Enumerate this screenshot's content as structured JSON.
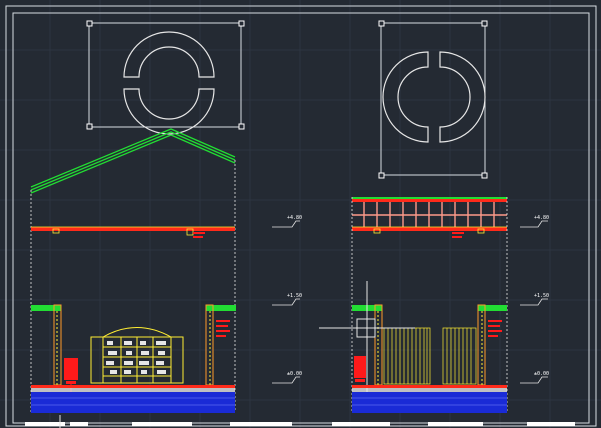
{
  "colors": {
    "background": "#242a33",
    "grid": "#2d3440",
    "frame": "#d9dde3",
    "roof": "#22dd33",
    "beam": "#ff2a1a",
    "annotation_red": "#ff1a1a",
    "furniture_yellow": "#ffee33",
    "floor_blue": "#1a2bd6",
    "wall_white": "#e6e6e6",
    "timber_pink": "#ff9a8a",
    "grip_white": "#ffffff"
  },
  "elevation_marks": {
    "left_section": [
      "+4.80",
      "+1.50",
      "±0.00"
    ],
    "right_section": [
      "+4.80",
      "+1.50",
      "±0.00"
    ]
  },
  "symbols": [
    "circular-window-horizontal",
    "circular-window-vertical"
  ]
}
